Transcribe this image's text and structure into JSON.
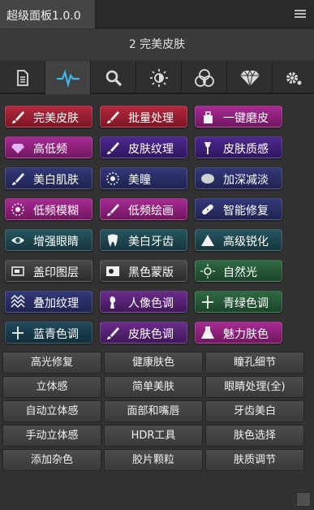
{
  "window": {
    "title": "超级面板1.0.0"
  },
  "subtitle": "2 完美皮肤",
  "tabs": [
    {
      "icon": "document-icon"
    },
    {
      "icon": "pulse-icon"
    },
    {
      "icon": "search-icon"
    },
    {
      "icon": "brightness-icon"
    },
    {
      "icon": "color-circles-icon"
    },
    {
      "icon": "diamond-icon"
    },
    {
      "icon": "settings-gear-icon"
    }
  ],
  "colored_buttons": [
    {
      "label": "完美皮肤",
      "icon": "brush-icon",
      "color": "#b3283d"
    },
    {
      "label": "批量处理",
      "icon": "brush-icon",
      "color": "#b3283d"
    },
    {
      "label": "一键磨皮",
      "icon": "bag-icon",
      "color": "#a72a93"
    },
    {
      "label": "高低频",
      "icon": "gem-icon",
      "color": "#a72a93"
    },
    {
      "label": "皮肤纹理",
      "icon": "brush-icon",
      "color": "#4e2890"
    },
    {
      "label": "皮肤质感",
      "icon": "tool-icon",
      "color": "#4e2890"
    },
    {
      "label": "美白肌肤",
      "icon": "brush-icon",
      "color": "#33397a"
    },
    {
      "label": "美瞳",
      "icon": "eye-ring-icon",
      "color": "#33397a"
    },
    {
      "label": "加深减淡",
      "icon": "blob-icon",
      "color": "#33397a"
    },
    {
      "label": "低频模糊",
      "icon": "eye-ring-icon",
      "color": "#a72a93"
    },
    {
      "label": "低频绘画",
      "icon": "brush-icon",
      "color": "#a72a93"
    },
    {
      "label": "智能修复",
      "icon": "bandage-icon",
      "color": "#33397a"
    },
    {
      "label": "增强眼睛",
      "icon": "eye-icon",
      "color": "#265660"
    },
    {
      "label": "美白牙齿",
      "icon": "tooth-icon",
      "color": "#265660"
    },
    {
      "label": "高级锐化",
      "icon": "triangle-icon",
      "color": "#265660"
    },
    {
      "label": "盖印图层",
      "icon": "stamp-icon",
      "color": "#4a4a4a"
    },
    {
      "label": "黑色蒙版",
      "icon": "mask-icon",
      "color": "#4a4a4a"
    },
    {
      "label": "自然光",
      "icon": "sun-icon",
      "color": "#2f6a44"
    },
    {
      "label": "叠加纹理",
      "icon": "texture-icon",
      "color": "#33397a"
    },
    {
      "label": "人像色调",
      "icon": "portrait-icon",
      "color": "#6a2c8a"
    },
    {
      "label": "青绿色调",
      "icon": "crosshair-icon",
      "color": "#2f6a44"
    },
    {
      "label": "蓝青色调",
      "icon": "crosshair-icon",
      "color": "#1f4a5c"
    },
    {
      "label": "皮肤色调",
      "icon": "brush-icon",
      "color": "#6a2c8a"
    },
    {
      "label": "魅力肤色",
      "icon": "flask-icon",
      "color": "#a72a93"
    }
  ],
  "gray_buttons": [
    "高光修复",
    "健康肤色",
    "瞳孔细节",
    "立体感",
    "简单美肤",
    "眼睛处理(全)",
    "自动立体感",
    "面部和嘴唇",
    "牙齿美白",
    "手动立体感",
    "HDR工具",
    "肤色选择",
    "添加杂色",
    "胶片颗粒",
    "肤质调节"
  ]
}
